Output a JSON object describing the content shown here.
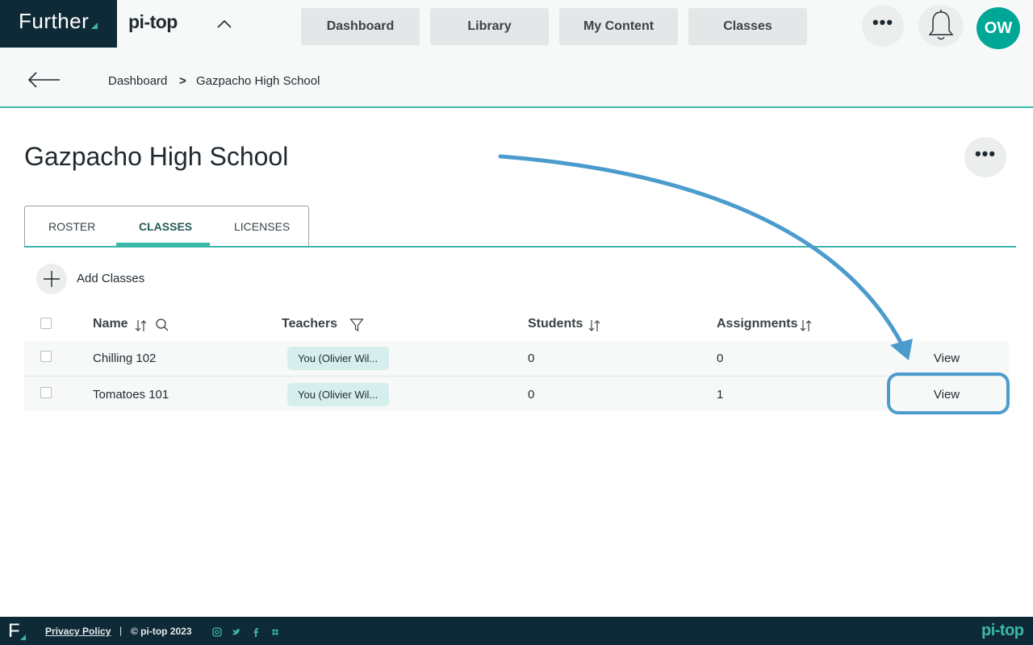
{
  "header": {
    "logo_text": "Further",
    "brand": "pi-top",
    "nav": [
      {
        "label": "Dashboard"
      },
      {
        "label": "Library"
      },
      {
        "label": "My Content"
      },
      {
        "label": "Classes"
      }
    ],
    "avatar_initials": "OW"
  },
  "breadcrumb": {
    "items": [
      {
        "label": "Dashboard"
      },
      {
        "label": "Gazpacho High School"
      }
    ],
    "separator": ">"
  },
  "page": {
    "title": "Gazpacho High School"
  },
  "tabs": [
    {
      "label": "ROSTER",
      "active": false
    },
    {
      "label": "CLASSES",
      "active": true
    },
    {
      "label": "LICENSES",
      "active": false
    }
  ],
  "add_classes_label": "Add Classes",
  "table": {
    "columns": [
      "Name",
      "Teachers",
      "Students",
      "Assignments"
    ],
    "rows": [
      {
        "name": "Chilling 102",
        "teacher": "You (Olivier Wil...",
        "students": "0",
        "assignments": "0",
        "action": "View"
      },
      {
        "name": "Tomatoes 101",
        "teacher": "You (Olivier Wil...",
        "students": "0",
        "assignments": "1",
        "action": "View"
      }
    ]
  },
  "footer": {
    "logo_letter": "F",
    "privacy_label": "Privacy Policy",
    "separator": "|",
    "copyright": "© pi-top 2023",
    "brand": "pi-top"
  },
  "colors": {
    "accent": "#3ab7a8",
    "navy": "#0f2a37",
    "annotation": "#4b9ccc",
    "avatar": "#00a797"
  }
}
